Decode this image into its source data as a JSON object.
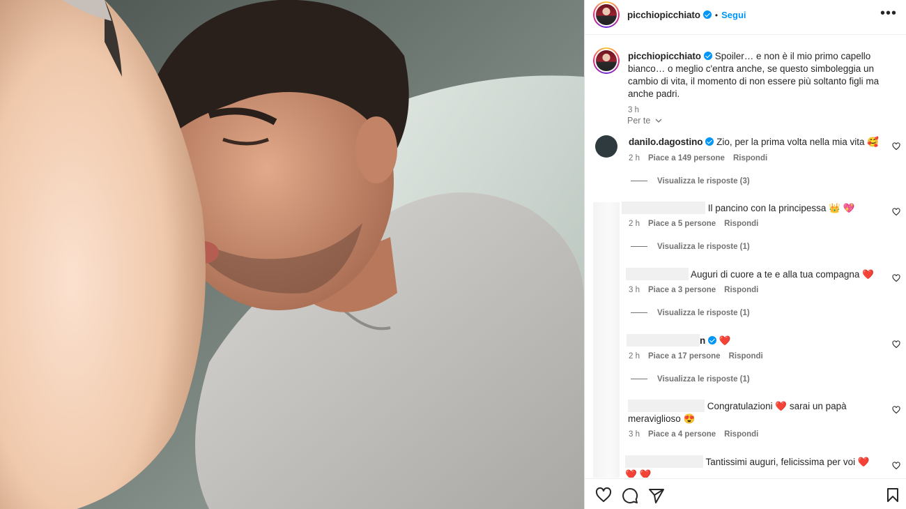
{
  "post": {
    "author": "picchiopicchiato",
    "follow_label": "Segui",
    "separator": "•",
    "more_label": "•••",
    "caption": "Spoiler… e non è il mio primo capello bianco… o meglio c'entra anche, se questo simboleggia un cambio di vita, il momento di non essere più soltanto figli ma anche padri.",
    "caption_time": "3 h"
  },
  "filter_label": "Per te",
  "comments": [
    {
      "user": "danilo.dagostino",
      "verified": true,
      "text": "Zio, per la prima volta nella mia vita 🥰",
      "time": "2 h",
      "likes": "Piace a 149 persone",
      "reply": "Rispondi",
      "replies": "Visualizza le risposte (3)"
    },
    {
      "user": "",
      "verified": false,
      "text": "Il pancino con la principessa 👑 💖",
      "time": "2 h",
      "likes": "Piace a 5 persone",
      "reply": "Rispondi",
      "replies": "Visualizza le risposte (1)"
    },
    {
      "user": "",
      "verified": false,
      "text": "Auguri di cuore a te e alla tua compagna ❤️",
      "time": "3 h",
      "likes": "Piace a 3 persone",
      "reply": "Rispondi",
      "replies": "Visualizza le risposte (1)"
    },
    {
      "user": "n",
      "verified": true,
      "text": "❤️",
      "time": "2 h",
      "likes": "Piace a 17 persone",
      "reply": "Rispondi",
      "replies": "Visualizza le risposte (1)"
    },
    {
      "user": "",
      "verified": false,
      "text": "Congratulazioni ❤️ sarai un papà meraviglioso 😍",
      "time": "3 h",
      "likes": "Piace a 4 persone",
      "reply": "Rispondi",
      "replies": ""
    },
    {
      "user": "",
      "verified": false,
      "text": "Tantissimi auguri, felicissima per voi ❤️❤️ ❤️",
      "time": "",
      "likes": "",
      "reply": "",
      "replies": ""
    }
  ],
  "icons": {
    "like": "heart-icon",
    "comment": "comment-icon",
    "share": "paper-plane-icon",
    "save": "bookmark-icon",
    "more": "more-horizontal-icon",
    "verified": "verified-badge-icon"
  },
  "colors": {
    "accent": "#0095f6",
    "text": "#262626",
    "secondary": "#737373",
    "border": "#dbdbdb"
  }
}
